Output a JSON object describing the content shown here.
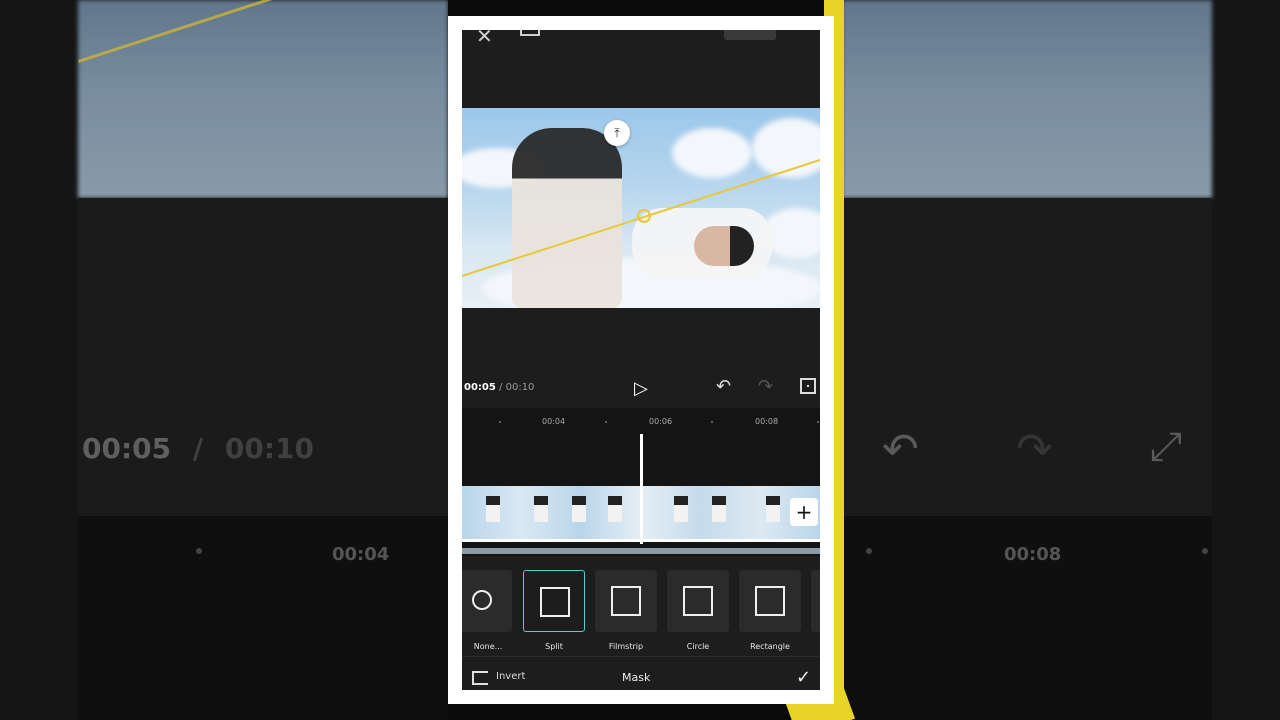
{
  "player": {
    "current_time": "00:05",
    "separator": "/",
    "duration": "00:10"
  },
  "timeline": {
    "ticks": [
      "00:04",
      "00:06",
      "00:08"
    ]
  },
  "mask_options": [
    {
      "label": "None...",
      "icon": "none-icon",
      "selected": false
    },
    {
      "label": "Split",
      "icon": "split-mask-icon",
      "selected": true
    },
    {
      "label": "Filmstrip",
      "icon": "filmstrip-mask-icon",
      "selected": false
    },
    {
      "label": "Circle",
      "icon": "circle-mask-icon",
      "selected": false
    },
    {
      "label": "Rectangle",
      "icon": "rectangle-mask-icon",
      "selected": false
    }
  ],
  "bottom_bar": {
    "invert_label": "Invert",
    "title": "Mask"
  },
  "background_overlay": {
    "current_time": "00:05",
    "separator": "/",
    "duration": "00:10",
    "tick_left": "00:04",
    "tick_right": "00:08"
  },
  "colors": {
    "accent_selection": "#4fd0d6",
    "mask_line": "#e8c83a",
    "frame_yellow": "#e8d328"
  }
}
